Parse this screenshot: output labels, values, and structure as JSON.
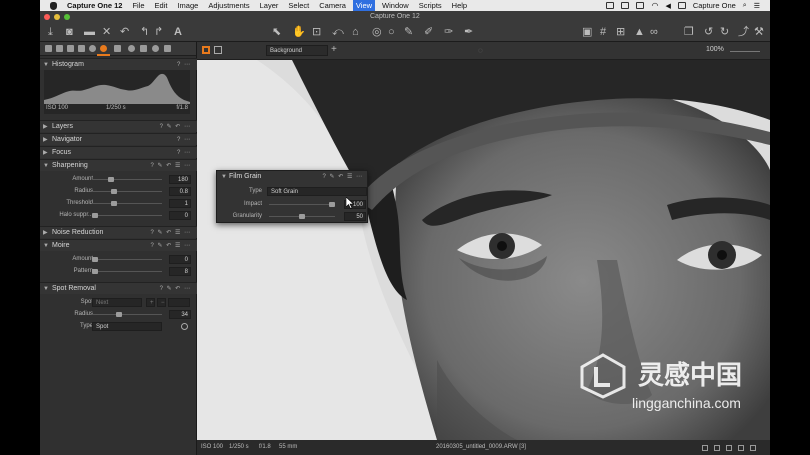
{
  "menubar": {
    "app_name": "Capture One 12",
    "items": [
      "File",
      "Edit",
      "Image",
      "Adjustments",
      "Layer",
      "Select",
      "Camera",
      "View",
      "Window",
      "Scripts",
      "Help"
    ],
    "active_item": "View",
    "right_app_name": "Capture One"
  },
  "window": {
    "title": "Capture One 12"
  },
  "viewer_top": {
    "variant_select": "Background",
    "zoom": "100%"
  },
  "histogram": {
    "label": "Histogram",
    "iso": "ISO 100",
    "shutter": "1/250 s",
    "aperture": "f/1.8"
  },
  "sections": {
    "layers": "Layers",
    "navigator": "Navigator",
    "focus": "Focus",
    "sharpening": "Sharpening",
    "noise_reduction": "Noise Reduction",
    "moire": "Moire",
    "spot_removal": "Spot Removal"
  },
  "sharpening": {
    "amount": {
      "label": "Amount",
      "value": 180,
      "fraction": 0.25
    },
    "radius": {
      "label": "Radius",
      "value": 0.8,
      "fraction": 0.3
    },
    "threshold": {
      "label": "Threshold",
      "value": 1,
      "fraction": 0.3
    },
    "halo": {
      "label": "Halo suppr...",
      "value": 0,
      "fraction": 0.0
    }
  },
  "moire": {
    "amount": {
      "label": "Amount",
      "value": 0,
      "fraction": 0.0
    },
    "pattern": {
      "label": "Pattern",
      "value": 8,
      "fraction": 0.0
    }
  },
  "spot_removal": {
    "spot_label": "Spot",
    "spot_value": "Next",
    "radius": {
      "label": "Radius",
      "value": 34,
      "fraction": 0.38
    },
    "type_label": "Type",
    "type_value": "Spot"
  },
  "film_grain": {
    "title": "Film Grain",
    "type_label": "Type",
    "type_value": "Soft Grain",
    "impact": {
      "label": "Impact",
      "value": 100,
      "fraction": 1.0
    },
    "granularity": {
      "label": "Granularity",
      "value": 50,
      "fraction": 0.5
    }
  },
  "statusbar": {
    "iso": "ISO 100",
    "shutter": "1/250 s",
    "aperture": "f/1.8",
    "focal": "55 mm",
    "filename": "20160305_untitled_0009.ARW [3]"
  },
  "watermark": {
    "brand": "灵感中国",
    "url": "lingganchina.com"
  },
  "colors": {
    "accent": "#e87a1d",
    "menu_highlight": "#2f6fe0"
  }
}
